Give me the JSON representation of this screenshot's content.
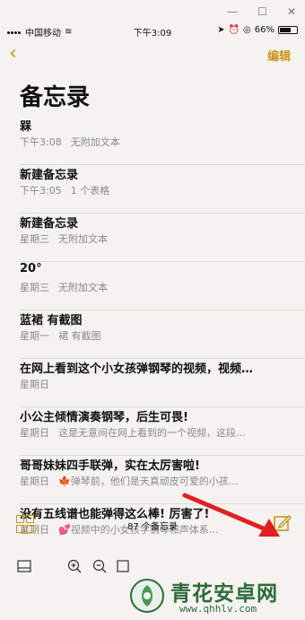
{
  "status_bar": {
    "carrier": "中国移动",
    "time": "下午3:09",
    "battery": "66%",
    "battery_level": 0.66
  },
  "nav": {
    "back_icon": "chevron-left-icon",
    "edit_label": "编辑"
  },
  "page_title": "备忘录",
  "notes": [
    {
      "title": "槑",
      "date": "下午3:08",
      "preview": "无附加文本"
    },
    {
      "title": "新建备忘录",
      "date": "下午3:05",
      "preview": "1 个表格"
    },
    {
      "title": "新建备忘录",
      "date": "星期三",
      "preview": "无附加文本"
    },
    {
      "title": "20°",
      "date": "星期三",
      "preview": "无附加文本"
    },
    {
      "title": "蓝裙 有截图",
      "date": "星期一",
      "preview": "裙 有截图"
    },
    {
      "title": "在网上看到这个小女孩弹钢琴的视频，视频…",
      "date": "星期日",
      "preview": ""
    },
    {
      "title": "小公主倾情演奏钢琴，后生可畏!",
      "date": "星期日",
      "preview": "这是无意间在网上看到的一个视频，这段…"
    },
    {
      "title": "哥哥妹妹四手联弹，实在太厉害啦!",
      "date": "星期日",
      "preview": "🍁弹琴前，他们是天真顽皮可爱的小孩…"
    },
    {
      "title": "没有五线谱也能弹得这么棒! 厉害了!",
      "date": "星期日",
      "preview": "💕视频中的小女孩学钢琴和声体系…"
    }
  ],
  "toolbar": {
    "count_label": "87 个备忘录"
  },
  "watermark": {
    "name": "青花安卓网",
    "url": "www.qhhlv.com"
  },
  "colors": {
    "accent": "#c8941c",
    "background": "#f4f3ef",
    "arrow": "#e02020"
  }
}
